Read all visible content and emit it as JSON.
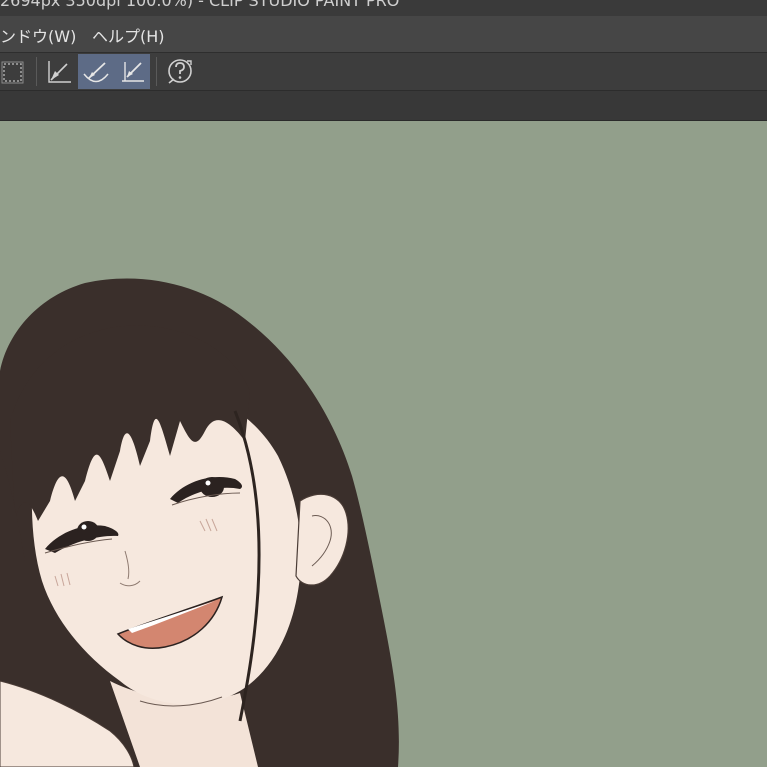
{
  "window": {
    "title": "2694px 350dpi 100.0%)  - CLIP STUDIO PAINT PRO"
  },
  "menu": {
    "items": [
      {
        "label": "ンドウ(W)"
      },
      {
        "label": "ヘルプ(H)"
      }
    ]
  },
  "toolbar": {
    "tools": [
      {
        "icon": "selection-frame-icon",
        "active": false
      },
      {
        "icon": "ruler-snap-icon",
        "active": false
      },
      {
        "icon": "curve-ruler-icon",
        "active": true
      },
      {
        "icon": "angle-ruler-icon",
        "active": true
      },
      {
        "icon": "help-question-icon",
        "active": false
      }
    ]
  },
  "canvas": {
    "background": "#929f8b",
    "artwork": "smiling-girl-illustration-icon"
  },
  "colors": {
    "hair": "#3a2f2b",
    "skin": "#f6e8de",
    "mouth": "#d38670",
    "active_tool": "#5d6b86"
  }
}
